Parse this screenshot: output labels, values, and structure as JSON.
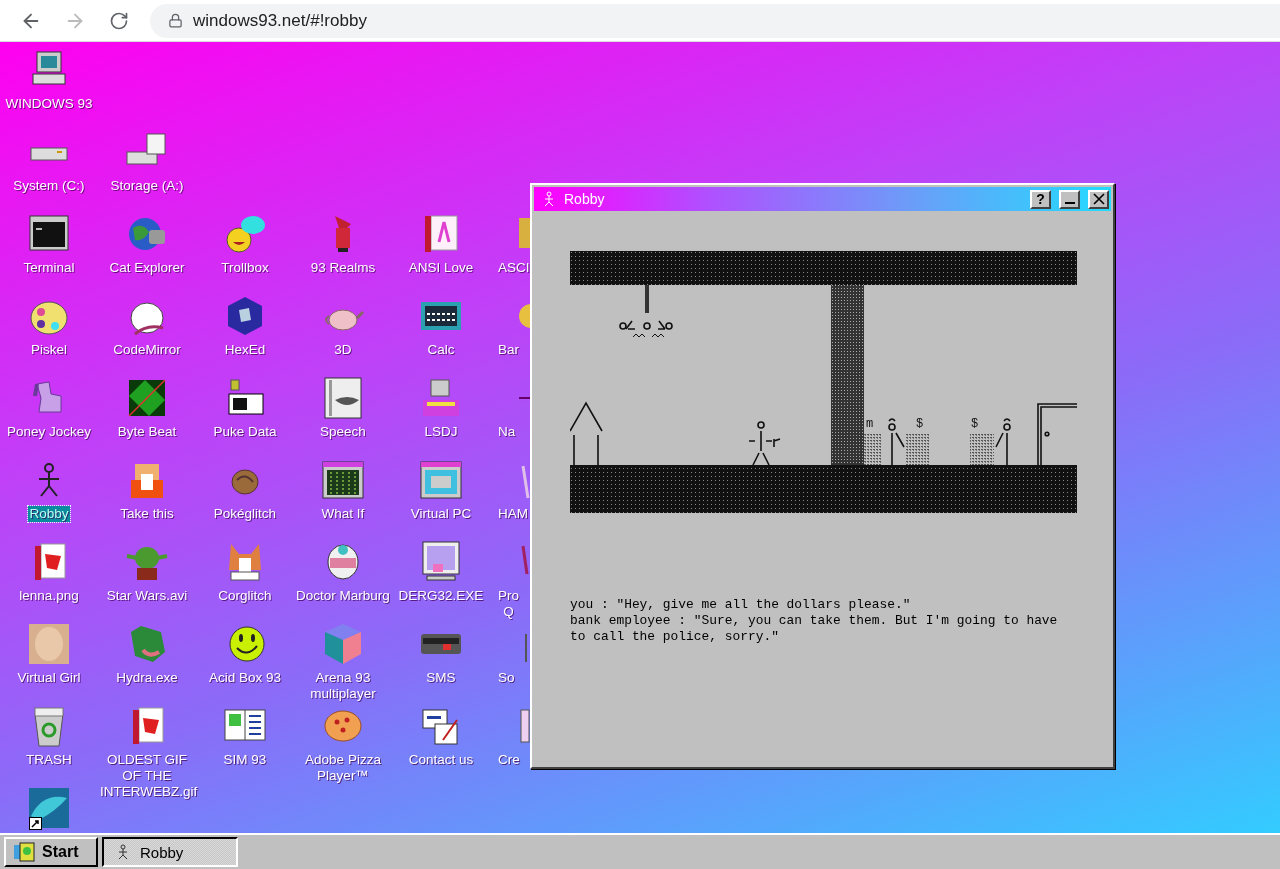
{
  "browser": {
    "url": "windows93.net/#!robby"
  },
  "desktop": {
    "rows": [
      {
        "icons": [
          {
            "label": "WINDOWS 93",
            "selected": false
          }
        ]
      },
      {
        "icons": [
          {
            "label": "System (C:)",
            "selected": false
          },
          {
            "label": "Storage (A:)",
            "selected": false
          }
        ]
      },
      {
        "icons": [
          {
            "label": "Terminal",
            "selected": false
          },
          {
            "label": "Cat Explorer",
            "selected": false
          },
          {
            "label": "Trollbox",
            "selected": false
          },
          {
            "label": "93 Realms",
            "selected": false
          },
          {
            "label": "ANSI Love",
            "selected": false
          },
          {
            "label": "ASCI",
            "selected": false
          }
        ]
      },
      {
        "icons": [
          {
            "label": "Piskel",
            "selected": false
          },
          {
            "label": "CodeMirror",
            "selected": false
          },
          {
            "label": "HexEd",
            "selected": false
          },
          {
            "label": "3D",
            "selected": false
          },
          {
            "label": "Calc",
            "selected": false
          },
          {
            "label": "Bar",
            "selected": false
          }
        ]
      },
      {
        "icons": [
          {
            "label": "Poney Jockey",
            "selected": false
          },
          {
            "label": "Byte Beat",
            "selected": false
          },
          {
            "label": "Puke Data",
            "selected": false
          },
          {
            "label": "Speech",
            "selected": false
          },
          {
            "label": "LSDJ",
            "selected": false
          },
          {
            "label": "Na",
            "selected": false
          }
        ]
      },
      {
        "icons": [
          {
            "label": "Robby",
            "selected": true
          },
          {
            "label": "Take this",
            "selected": false
          },
          {
            "label": "Pokéglitch",
            "selected": false
          },
          {
            "label": "What If",
            "selected": false
          },
          {
            "label": "Virtual PC",
            "selected": false
          },
          {
            "label": "HAM",
            "selected": false
          }
        ]
      },
      {
        "icons": [
          {
            "label": "lenna.png",
            "selected": false
          },
          {
            "label": "Star Wars.avi",
            "selected": false
          },
          {
            "label": "Corglitch",
            "selected": false
          },
          {
            "label": "Doctor Marburg",
            "selected": false
          },
          {
            "label": "DERG32.EXE",
            "selected": false
          },
          {
            "label": "Pro\nQ",
            "selected": false
          }
        ]
      },
      {
        "icons": [
          {
            "label": "Virtual Girl",
            "selected": false
          },
          {
            "label": "Hydra.exe",
            "selected": false
          },
          {
            "label": "Acid Box 93",
            "selected": false
          },
          {
            "label": "Arena 93 multiplayer",
            "selected": false
          },
          {
            "label": "SMS",
            "selected": false
          },
          {
            "label": "So",
            "selected": false
          }
        ]
      },
      {
        "icons": [
          {
            "label": "TRASH",
            "selected": false
          },
          {
            "label": "OLDEST GIF OF THE INTERWEBZ.gif",
            "selected": false
          },
          {
            "label": "SIM 93",
            "selected": false
          },
          {
            "label": "Adobe Pizza Player™",
            "selected": false
          },
          {
            "label": "Contact us",
            "selected": false
          },
          {
            "label": "Cre",
            "selected": false
          }
        ]
      },
      {
        "icons": [
          {
            "shortcut": true
          }
        ]
      }
    ]
  },
  "window": {
    "title": "Robby",
    "help_button": "?",
    "scene": {
      "marks": [
        "m",
        "$",
        "$"
      ]
    },
    "dialogue": [
      "you : \"Hey, give me all the dollars please.\"",
      "bank employee : \"Sure, you can take them. But I'm going to have to call the police, sorry.\""
    ]
  },
  "taskbar": {
    "start": "Start",
    "tasks": [
      {
        "label": "Robby",
        "active": true
      }
    ]
  }
}
